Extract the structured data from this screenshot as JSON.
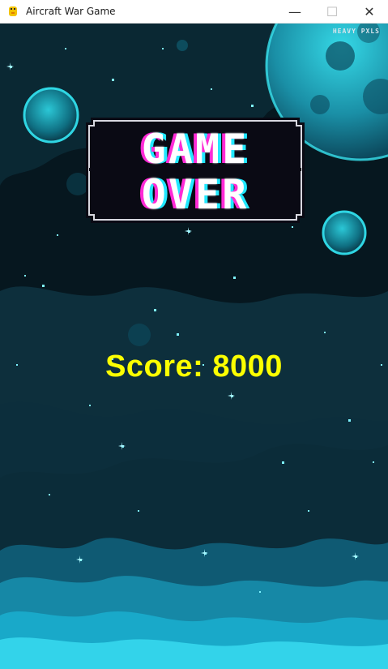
{
  "window": {
    "title": "Aircraft War Game",
    "controls": {
      "minimize": "—",
      "maximize": "☐",
      "close": "✕"
    }
  },
  "game": {
    "credit": "HEAVY PXLS",
    "game_over_line1": "GAME",
    "game_over_line2": "OVER",
    "score_text": "Score: 8000"
  },
  "colors": {
    "score": "#fcff00",
    "space_dark": "#06171f",
    "nebula": "#0f3b4a",
    "planet": "#1fb7c9",
    "glitch_magenta": "#ff2bd6",
    "glitch_cyan": "#21e8ff"
  }
}
